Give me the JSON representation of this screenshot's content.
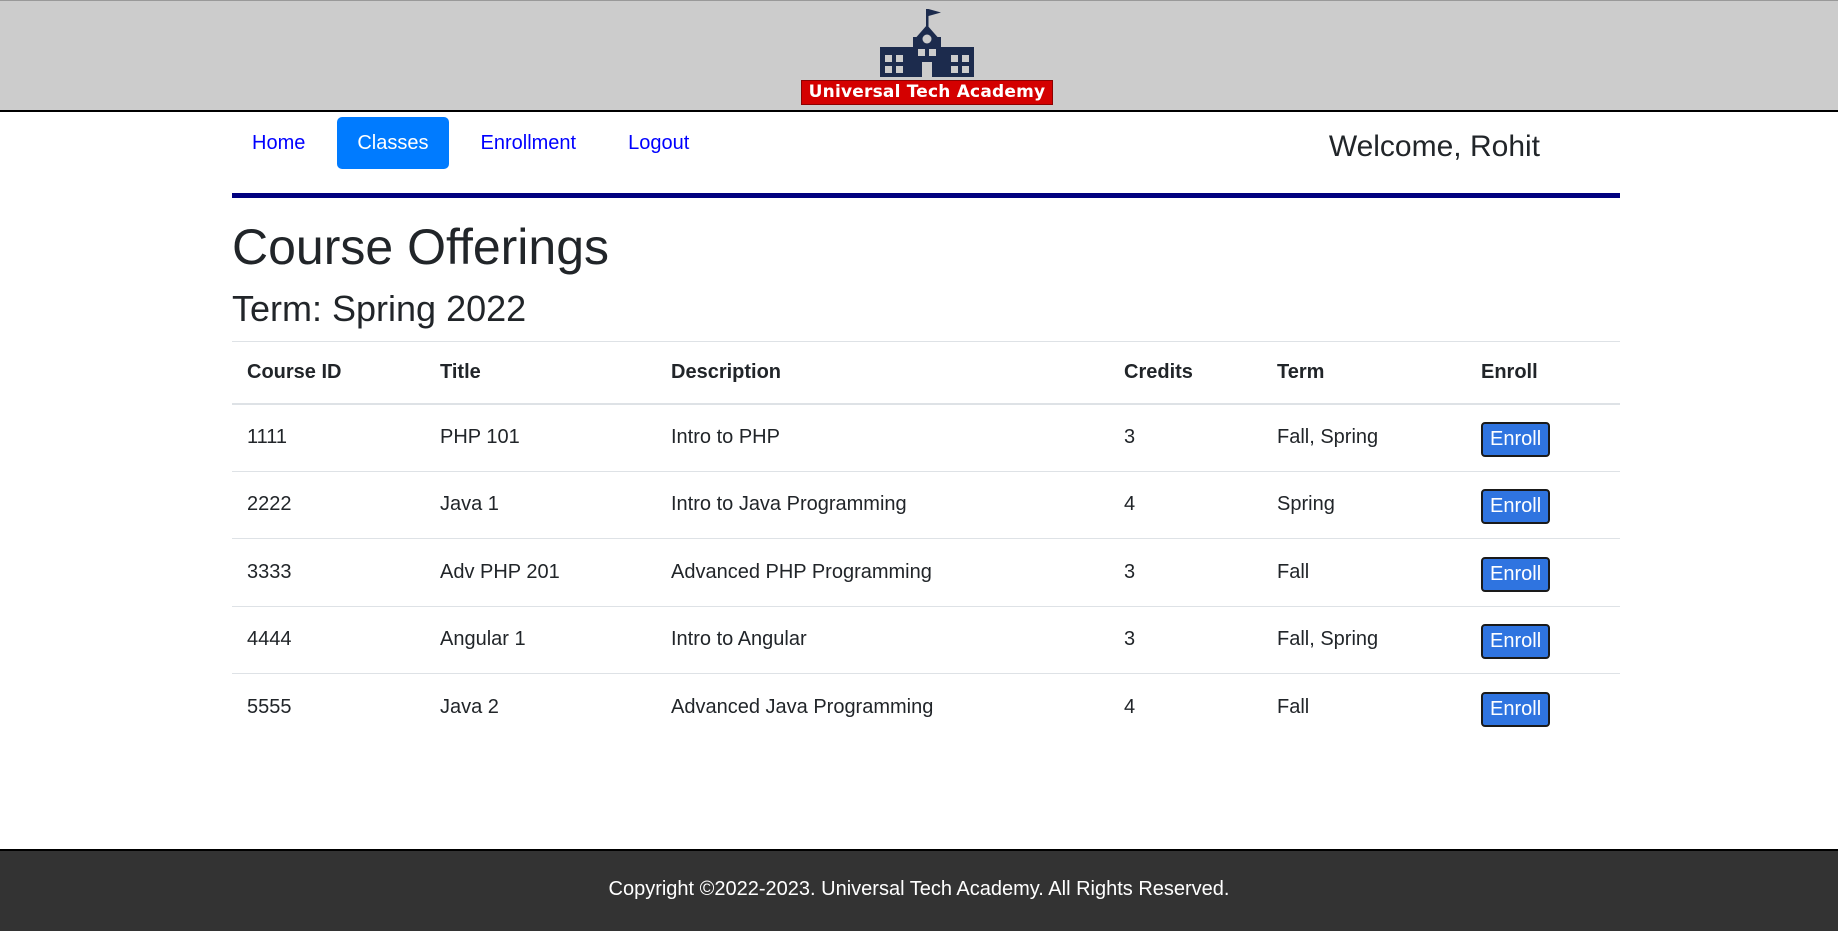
{
  "header": {
    "logo_text": "Universal Tech Academy",
    "logo_icon": "school-building-icon",
    "colors": {
      "banner": "#d40000",
      "building": "#1c2b4d",
      "topbar": "#cccccc"
    }
  },
  "nav": {
    "items": [
      {
        "label": "Home",
        "active": false
      },
      {
        "label": "Classes",
        "active": true
      },
      {
        "label": "Enrollment",
        "active": false
      },
      {
        "label": "Logout",
        "active": false
      }
    ],
    "active_color": "#007bff",
    "link_color": "#0000ff"
  },
  "welcome": "Welcome, Rohit",
  "main": {
    "title": "Course Offerings",
    "term": "Term: Spring 2022"
  },
  "table": {
    "headers": [
      "Course ID",
      "Title",
      "Description",
      "Credits",
      "Term",
      "Enroll"
    ],
    "rows": [
      {
        "id": "1111",
        "title": "PHP 101",
        "description": "Intro to PHP",
        "credits": "3",
        "term": "Fall, Spring",
        "button": "Enroll"
      },
      {
        "id": "2222",
        "title": "Java 1",
        "description": "Intro to Java Programming",
        "credits": "4",
        "term": "Spring",
        "button": "Enroll"
      },
      {
        "id": "3333",
        "title": "Adv PHP 201",
        "description": "Advanced PHP Programming",
        "credits": "3",
        "term": "Fall",
        "button": "Enroll"
      },
      {
        "id": "4444",
        "title": "Angular 1",
        "description": "Intro to Angular",
        "credits": "3",
        "term": "Fall, Spring",
        "button": "Enroll"
      },
      {
        "id": "5555",
        "title": "Java 2",
        "description": "Advanced Java Programming",
        "credits": "4",
        "term": "Fall",
        "button": "Enroll"
      }
    ]
  },
  "footer": {
    "text": "Copyright ©2022-2023. Universal Tech Academy. All Rights Reserved."
  }
}
